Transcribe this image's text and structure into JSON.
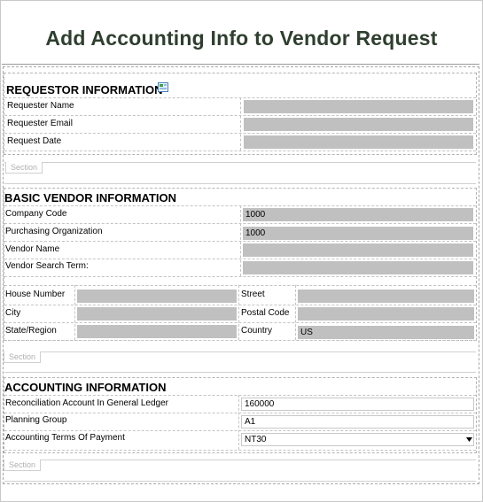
{
  "title": "Add Accounting Info to Vendor Request",
  "requestor": {
    "heading": "REQUESTOR INFORMATION",
    "name_label": "Requester Name",
    "email_label": "Requester Email",
    "date_label": "Request Date",
    "section_tab": "Section"
  },
  "vendor": {
    "heading": "BASIC VENDOR INFORMATION",
    "company_code_label": "Company Code",
    "company_code_value": "1000",
    "purch_org_label": "Purchasing Organization",
    "purch_org_value": "1000",
    "vendor_name_label": "Vendor Name",
    "search_term_label": "Vendor Search Term:",
    "house_label": "House Number",
    "street_label": "Street",
    "city_label": "City",
    "postal_label": "Postal Code",
    "state_label": "State/Region",
    "country_label": "Country",
    "country_value": "US",
    "section_tab": "Section"
  },
  "accounting": {
    "heading": "ACCOUNTING INFORMATION",
    "recon_label": "Reconciliation Account In General Ledger",
    "recon_value": "160000",
    "planning_label": "Planning Group",
    "planning_value": "A1",
    "terms_label": "Accounting Terms Of Payment",
    "terms_value": "NT30",
    "section_tab": "Section"
  },
  "icons": {
    "heading_icon": "form-icon",
    "dropdown": "chevron-down-icon"
  }
}
